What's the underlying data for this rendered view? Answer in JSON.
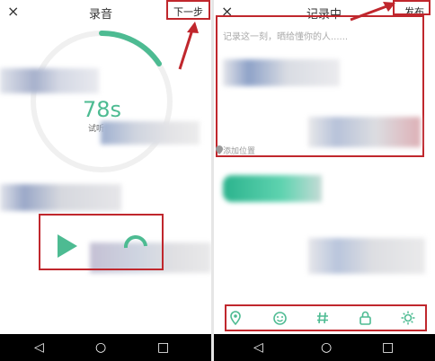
{
  "left_screen": {
    "title": "录音",
    "close_icon": "×",
    "next_button": "下一步",
    "timer": "78s",
    "hint_prefix": "试听",
    "accent": "#4dbb92",
    "play_icon": "play-triangle",
    "annotation_color": "#c0272d"
  },
  "right_screen": {
    "title": "记录中",
    "close_icon": "×",
    "publish_button": "发布",
    "compose_placeholder": "记录这一刻，晒给懂你的人......",
    "add_location": "添加位置",
    "toolbar_icons": [
      "location-pin-icon",
      "emoji-icon",
      "hashtag-icon",
      "lock-icon",
      "brightness-icon"
    ]
  },
  "system_nav": {
    "back": "◁",
    "home": "○",
    "recents": "□"
  }
}
